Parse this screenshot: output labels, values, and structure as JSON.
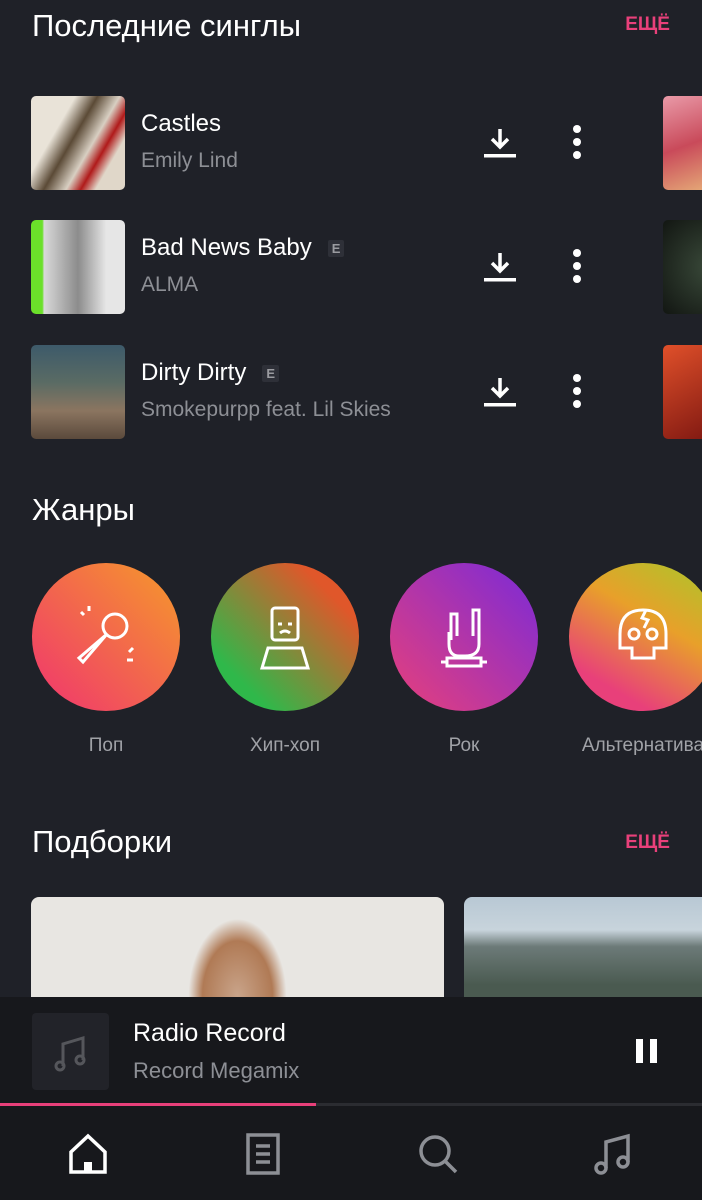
{
  "singles": {
    "title": "Последние синглы",
    "more_label": "ЕЩЁ",
    "tracks": [
      {
        "title": "Castles",
        "artist": "Emily Lind",
        "explicit": false
      },
      {
        "title": "Bad News Baby",
        "artist": "ALMA",
        "explicit": true
      },
      {
        "title": "Dirty Dirty",
        "artist": "Smokepurpp feat. Lil Skies",
        "explicit": true
      }
    ],
    "explicit_badge": "E"
  },
  "genres": {
    "title": "Жанры",
    "items": [
      {
        "label": "Поп",
        "icon": "microphone-icon"
      },
      {
        "label": "Хип-хоп",
        "icon": "hiphop-figure-icon"
      },
      {
        "label": "Рок",
        "icon": "rock-hand-icon"
      },
      {
        "label": "Альтернатива",
        "icon": "skull-icon"
      }
    ]
  },
  "collections": {
    "title": "Подборки",
    "more_label": "ЕЩЁ"
  },
  "player": {
    "title": "Radio Record",
    "subtitle": "Record Megamix",
    "progress_percent": 45,
    "state": "playing"
  },
  "nav": {
    "items": [
      "home-icon",
      "library-icon",
      "search-icon",
      "music-icon"
    ],
    "active": "home-icon"
  },
  "colors": {
    "accent": "#e8407a",
    "background": "#1f2128",
    "player": "#17181c"
  }
}
